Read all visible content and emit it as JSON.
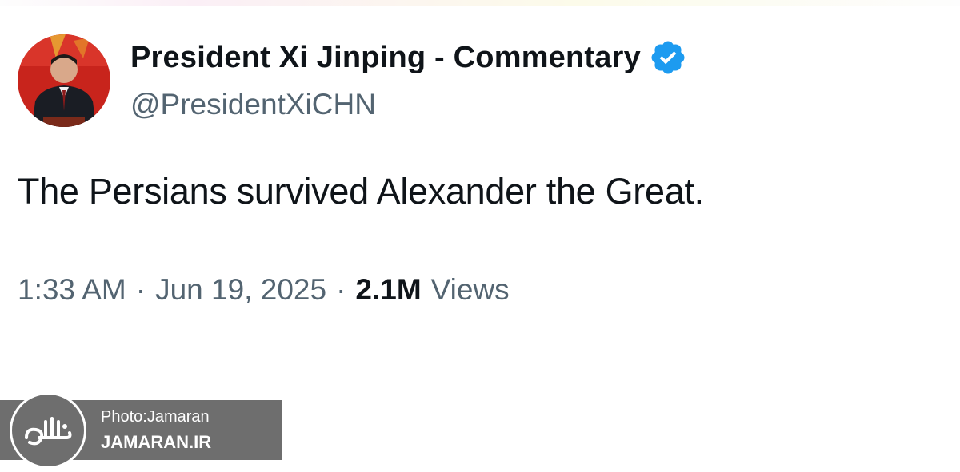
{
  "tweet": {
    "author": {
      "display_name": "President Xi Jinping - Commentary",
      "handle": "@PresidentXiCHN",
      "verified": true,
      "avatar_icon": "profile-photo"
    },
    "text": "The Persians survived Alexander the Great.",
    "timestamp": {
      "time": "1:33 AM",
      "separator": "·",
      "date": "Jun 19, 2025"
    },
    "views": {
      "count": "2.1M",
      "label": "Views"
    }
  },
  "watermark": {
    "credit": "Photo:Jamaran",
    "site": "JAMARAN.IR",
    "logo_icon": "jamaran-logo"
  },
  "colors": {
    "text_primary": "#0f1419",
    "text_secondary": "#536471",
    "verified_blue": "#1d9bf0",
    "watermark_gray": "#6e6e6e"
  }
}
